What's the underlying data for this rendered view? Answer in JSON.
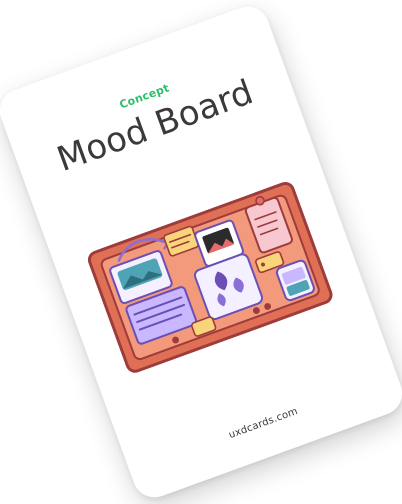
{
  "card": {
    "category": "Concept",
    "title": "Mood Board",
    "footer": "uxdcards.com"
  },
  "illustration": {
    "icon": "mood-board-icon",
    "colors": {
      "frame": "#e07055",
      "frame_dark": "#9e3b3b",
      "board": "#f39a7c",
      "note_yellow": "#f8d57a",
      "paper": "#f4f0ff",
      "accent_purple": "#8b6fd6",
      "accent_teal": "#4fa3b6"
    }
  },
  "colors": {
    "accent": "#2fbe6a",
    "text": "#3a3a3a",
    "card": "#ffffff"
  }
}
